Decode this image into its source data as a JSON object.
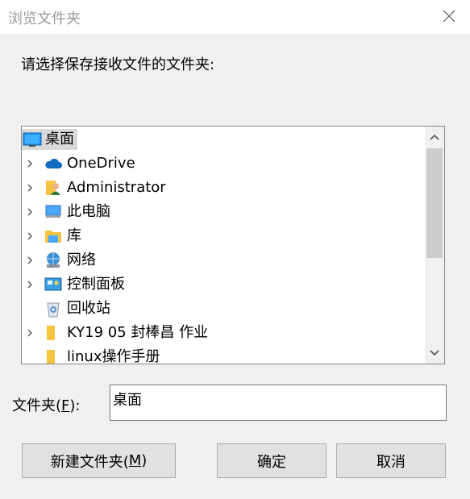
{
  "window": {
    "title": "浏览文件夹",
    "close_icon": "close-icon"
  },
  "prompt": "请选择保存接收文件的文件夹:",
  "tree": {
    "items": [
      {
        "label": "桌面",
        "icon": "desktop-icon",
        "expandable": false,
        "selected": true
      },
      {
        "label": "OneDrive",
        "icon": "cloud-icon",
        "expandable": true,
        "selected": false
      },
      {
        "label": "Administrator",
        "icon": "user-folder-icon",
        "expandable": true,
        "selected": false
      },
      {
        "label": "此电脑",
        "icon": "computer-icon",
        "expandable": true,
        "selected": false
      },
      {
        "label": "库",
        "icon": "library-icon",
        "expandable": true,
        "selected": false
      },
      {
        "label": "网络",
        "icon": "network-icon",
        "expandable": true,
        "selected": false
      },
      {
        "label": "控制面板",
        "icon": "control-panel-icon",
        "expandable": true,
        "selected": false
      },
      {
        "label": "回收站",
        "icon": "recycle-bin-icon",
        "expandable": false,
        "selected": false
      },
      {
        "label": "KY19  05 封棒昌  作业",
        "icon": "folder-icon",
        "expandable": true,
        "selected": false
      },
      {
        "label": "linux操作手册",
        "icon": "folder-icon",
        "expandable": false,
        "selected": false
      }
    ]
  },
  "folder_field": {
    "label_prefix": "文件夹(",
    "label_key": "F",
    "label_suffix": "):",
    "value": "桌面"
  },
  "buttons": {
    "new_folder_prefix": "新建文件夹(",
    "new_folder_key": "M",
    "new_folder_suffix": ")",
    "ok": "确定",
    "cancel": "取消"
  },
  "colors": {
    "titlebar": "#ffffff",
    "dialog": "#f0f0f0",
    "selection": "#d9d9d9",
    "folder": "#f6c343",
    "onedrive": "#0f6cbd"
  }
}
